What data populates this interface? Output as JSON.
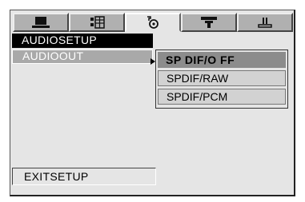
{
  "tabs": [
    {
      "icon": "tv-monitor-icon",
      "active": false
    },
    {
      "icon": "speaker-grid-icon",
      "active": false
    },
    {
      "icon": "audio-note-icon",
      "active": true
    },
    {
      "icon": "video-flag-icon",
      "active": false
    },
    {
      "icon": "preference-tray-icon",
      "active": false
    }
  ],
  "menu": {
    "title": "AUDIOSETUP",
    "audio_out_label": "AUDIOOUT",
    "exit_label": "EXITSETUP"
  },
  "submenu": {
    "options": [
      {
        "label": "SP DIF/O FF",
        "selected": true
      },
      {
        "label": "SPDIF/RAW",
        "selected": false
      },
      {
        "label": "SPDIF/PCM",
        "selected": false
      }
    ]
  },
  "colors": {
    "panel": "#e5e5e5",
    "highlight": "#a9a9a9",
    "title_bg": "#000000",
    "selected_option": "#8c8c8c"
  }
}
